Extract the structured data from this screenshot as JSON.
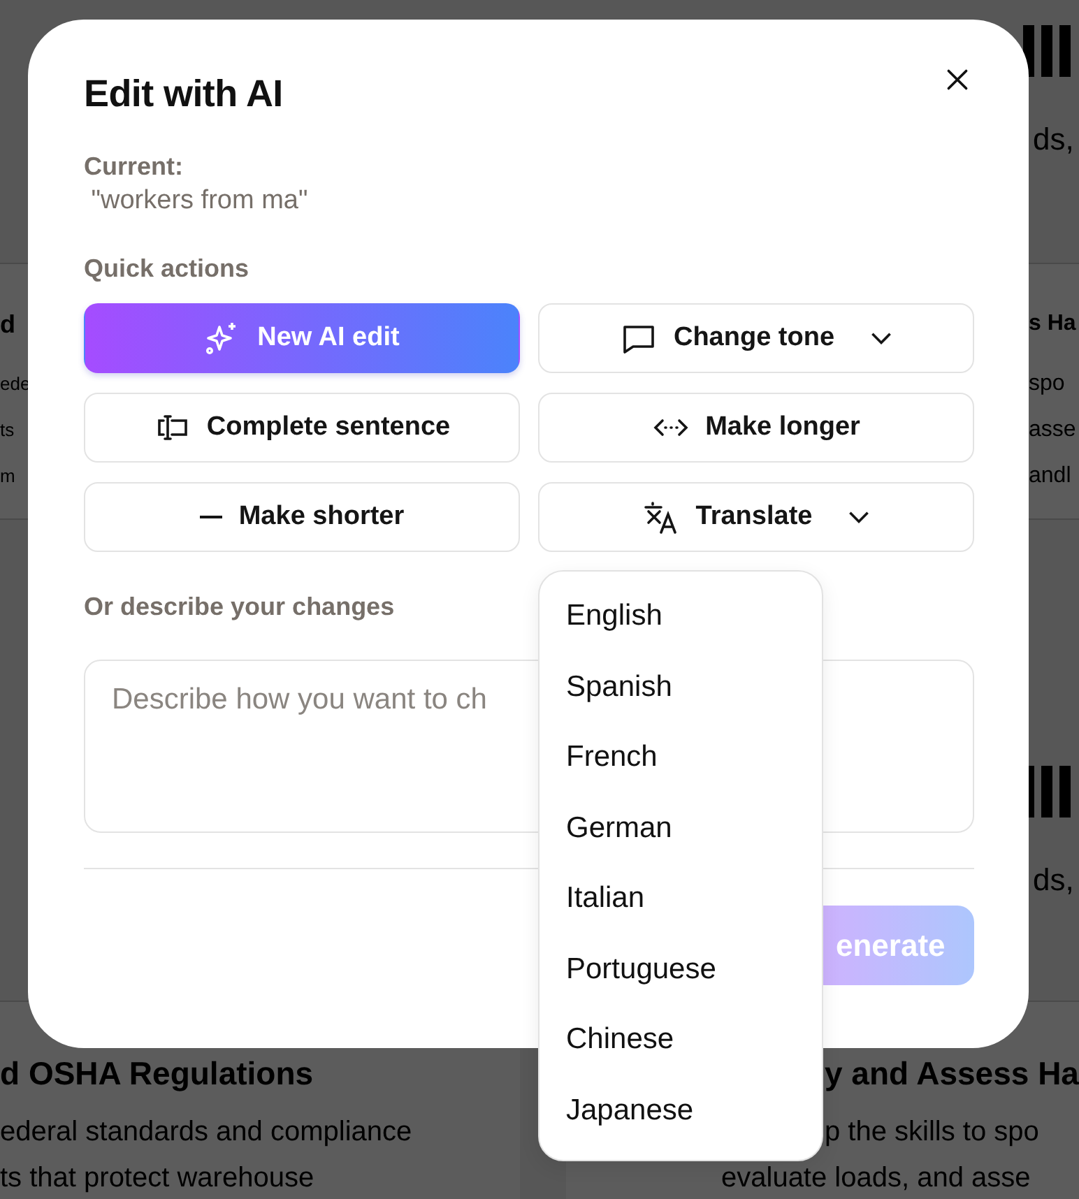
{
  "background": {
    "top_band": {
      "text": "ds,"
    },
    "card_rows": [
      {
        "left": {
          "heading": "d",
          "lines": [
            "ede",
            "ts",
            "m"
          ]
        },
        "right": {
          "heading": "s Ha",
          "lines": [
            "spo",
            "asse",
            "andl"
          ]
        }
      }
    ],
    "middle_band": {
      "text": "ds,"
    },
    "bottom_row": {
      "left": {
        "heading": "d OSHA Regulations",
        "lines": [
          "ederal standards and compliance",
          "ts that protect warehouse"
        ]
      },
      "right": {
        "heading": "y and Assess Ha",
        "lines": [
          "p the skills to spo",
          "evaluate loads, and asse"
        ]
      }
    }
  },
  "dialog": {
    "title": "Edit with AI",
    "current_label": "Current:",
    "current_value": " \"workers from ma\"",
    "quick_actions_label": "Quick actions",
    "actions": [
      {
        "label": "New AI edit",
        "kind": "sparkles",
        "selected": true,
        "dropdown": false
      },
      {
        "label": "Change tone",
        "kind": "speech",
        "selected": false,
        "dropdown": true
      },
      {
        "label": "Complete sentence",
        "kind": "cursor",
        "selected": false,
        "dropdown": false
      },
      {
        "label": "Make longer",
        "kind": "expand",
        "selected": false,
        "dropdown": false
      },
      {
        "label": "Make shorter",
        "kind": "minus",
        "selected": false,
        "dropdown": false
      },
      {
        "label": "Translate",
        "kind": "translate",
        "selected": false,
        "dropdown": true
      }
    ],
    "describe_label": "Or describe your changes",
    "describe": {
      "placeholder": "Describe how you want to ch"
    },
    "generate": {
      "label": "enerate",
      "disabled": true
    },
    "language_menu": [
      "English",
      "Spanish",
      "French",
      "German",
      "Italian",
      "Portuguese",
      "Chinese",
      "Japanese"
    ]
  }
}
